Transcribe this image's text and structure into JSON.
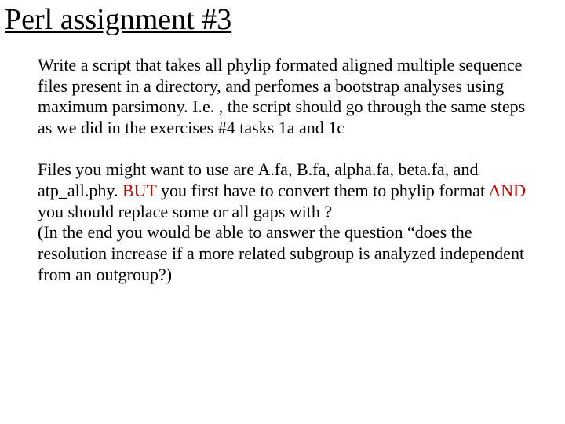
{
  "title": "Perl assignment #3",
  "para1": "Write a script that takes all phylip formated aligned multiple sequence files present in a directory, and perfomes a bootstrap analyses using maximum parsimony. I.e. , the script should go through the same steps as we did in the exercises #4 tasks 1a and 1c",
  "para2": {
    "t1": "Files you might want to use are A.fa, B.fa, alpha.fa, beta.fa, and atp_all.phy.  ",
    "h1": "BUT",
    "t2": " you first have to convert them to phylip format ",
    "h2": "AND",
    "t3": " you should replace some or all gaps with ?",
    "t4": "(In the end you would be able to answer the question “does the resolution increase if a more related subgroup is analyzed independent from an outgroup?)"
  }
}
